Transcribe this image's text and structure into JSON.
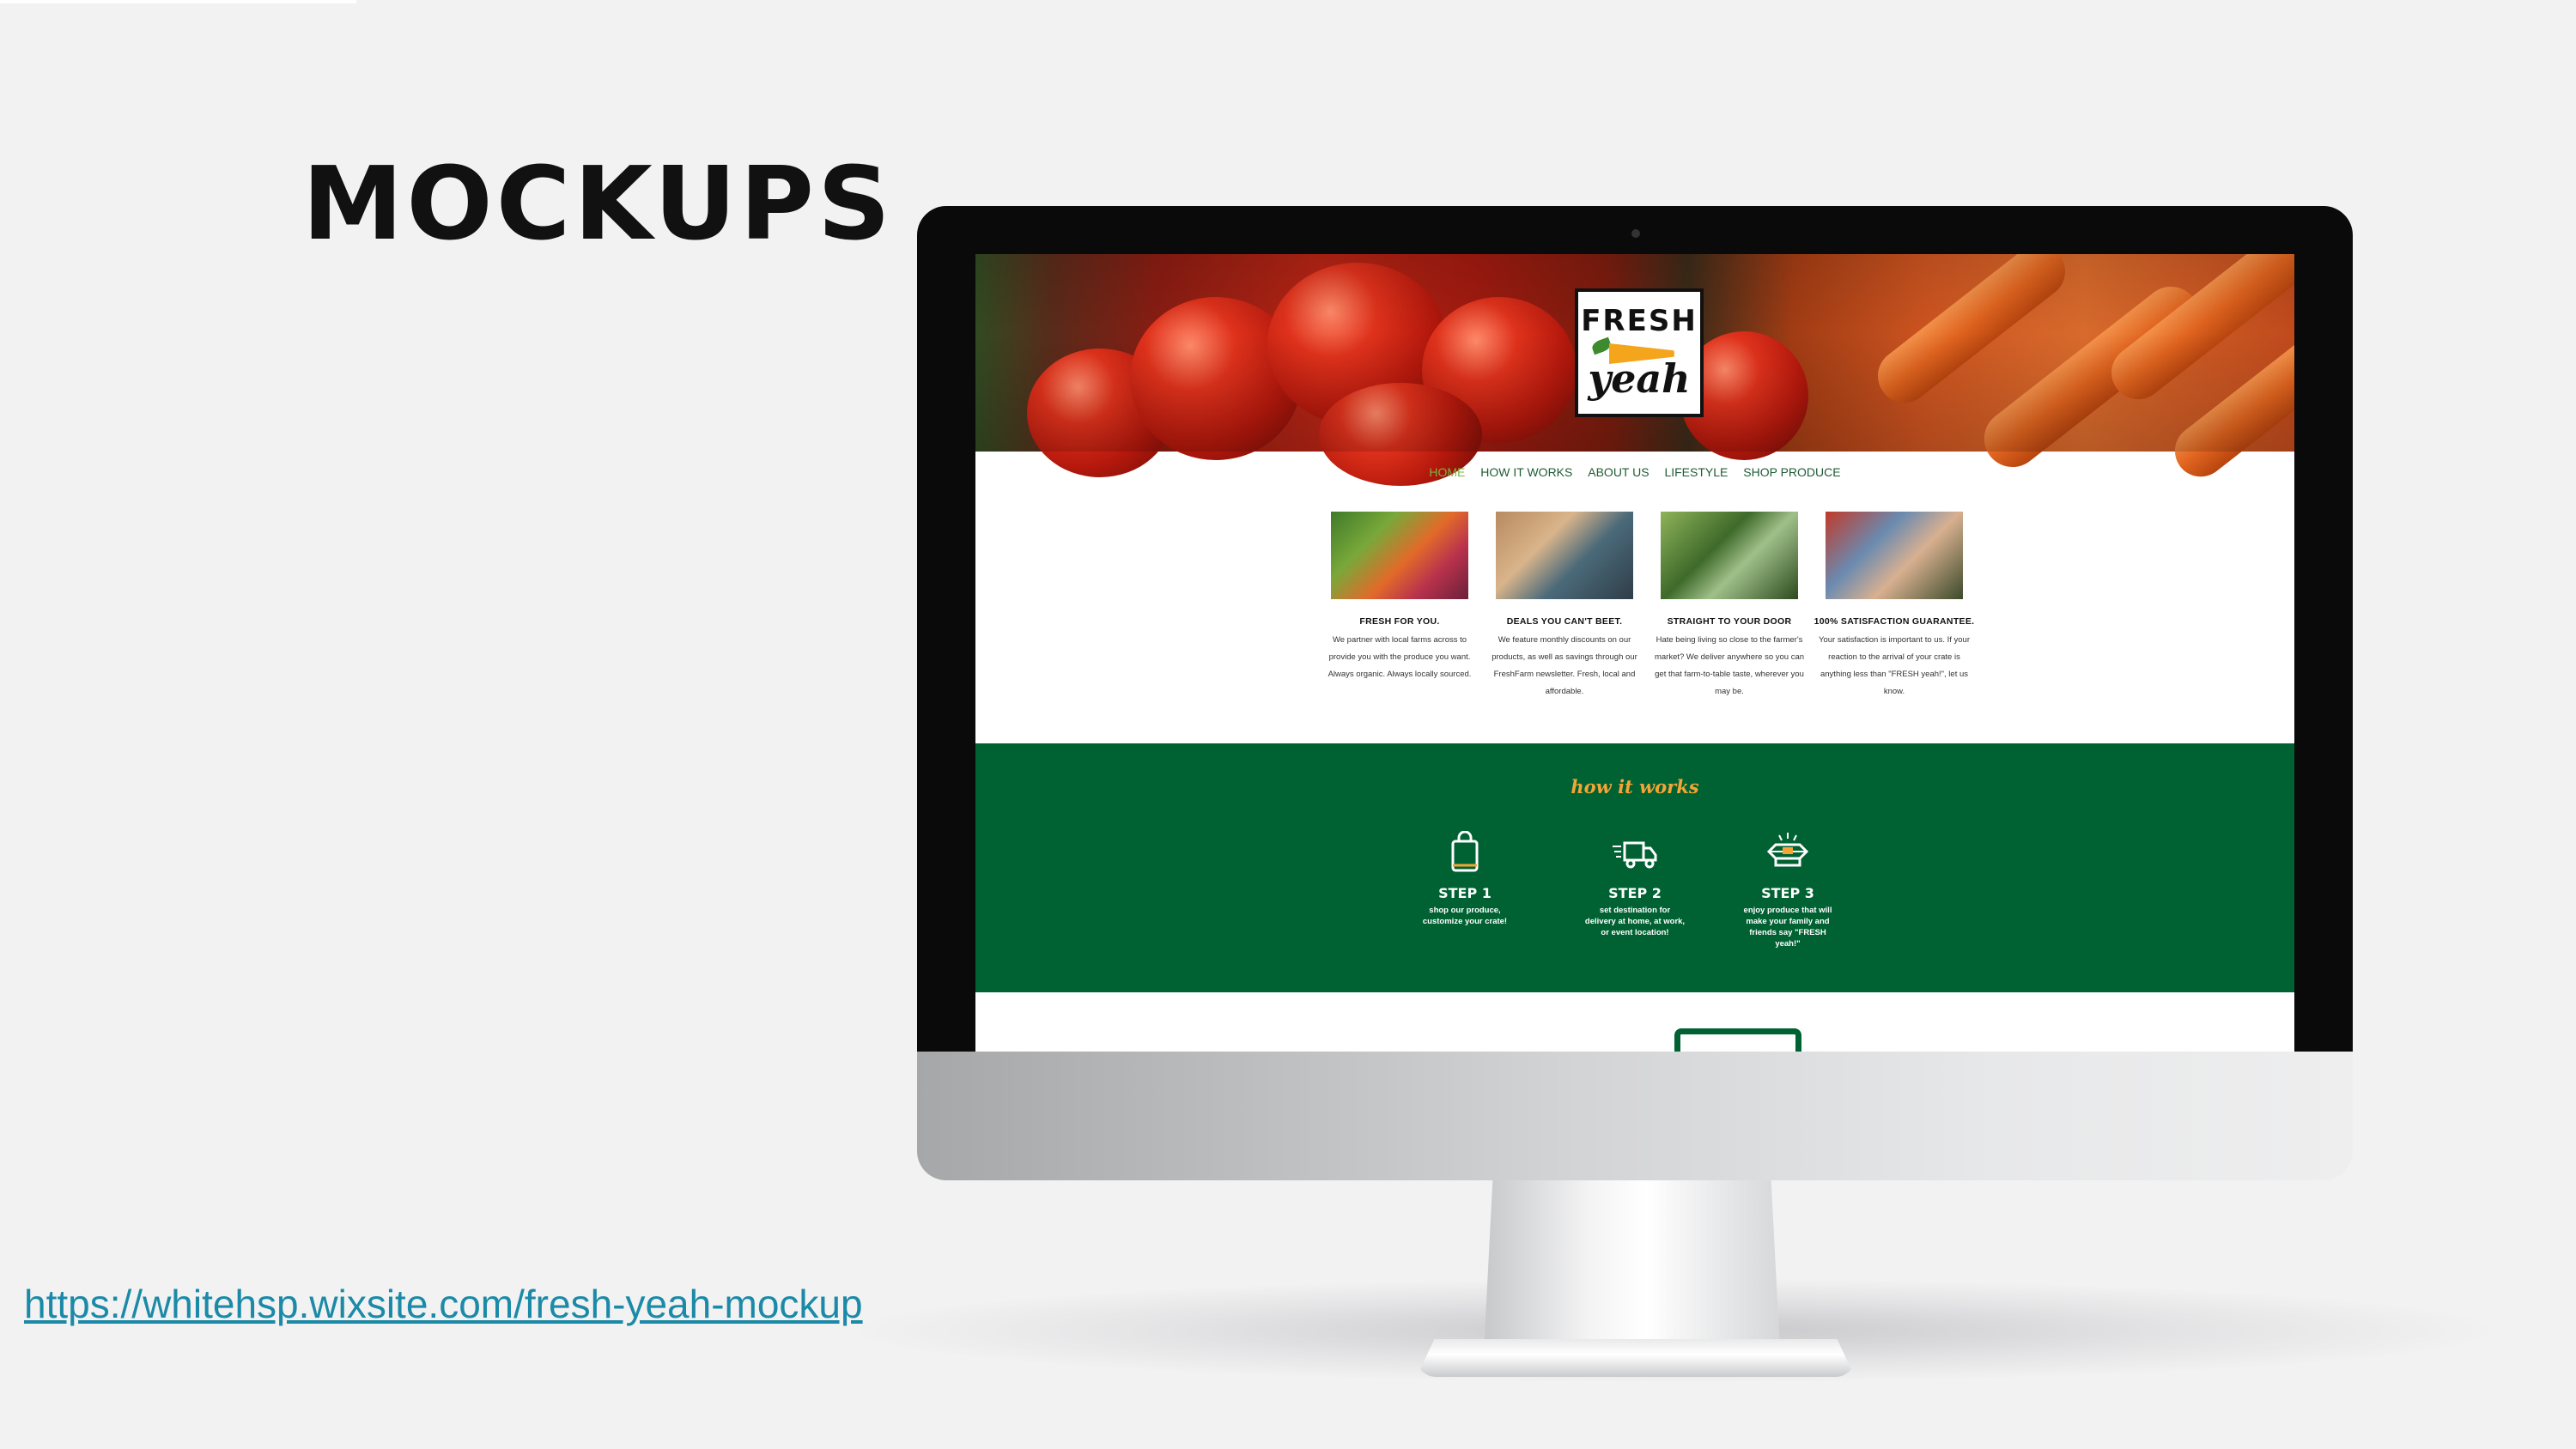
{
  "slide": {
    "title": "MOCKUPS",
    "link": "https://whitehsp.wixsite.com/fresh-yeah-mockup"
  },
  "site": {
    "logo": {
      "top": "FRESH",
      "bottom": "yeah"
    },
    "nav": [
      "HOME",
      "HOW IT WORKS",
      "ABOUT US",
      "LIFESTYLE",
      "SHOP PRODUCE"
    ],
    "features": [
      {
        "title": "FRESH FOR YOU.",
        "text": "We partner with local farms across to provide you with the produce you want. Always organic. Always locally sourced."
      },
      {
        "title": "DEALS YOU CAN'T BEET.",
        "text": "We feature monthly discounts on our products, as well as savings through our FreshFarm newsletter. Fresh, local and affordable."
      },
      {
        "title": "STRAIGHT TO YOUR DOOR",
        "text": "Hate being living so close to the farmer's market? We deliver anywhere so you can get that farm-to-table taste, wherever you may be."
      },
      {
        "title": "100% SATISFACTION GUARANTEE.",
        "text": "Your satisfaction is important to us. If your reaction to the arrival of your crate is anything less than \"FRESH yeah!\", let us know."
      }
    ],
    "how_it_works": {
      "title": "how it works",
      "steps": [
        {
          "label": "STEP 1",
          "text": "shop our produce, customize your crate!",
          "icon": "shopping-bag-icon"
        },
        {
          "label": "STEP 2",
          "text": "set destination for delivery at home, at work, or event location!",
          "icon": "delivery-truck-icon"
        },
        {
          "label": "STEP 3",
          "text": "enjoy produce that will make your family and friends say \"FRESH yeah!\"",
          "icon": "open-crate-icon"
        }
      ]
    }
  },
  "colors": {
    "brand_green": "#006233",
    "accent_orange": "#f4a535",
    "nav_active": "#7cb342",
    "link": "#1b8aa8"
  }
}
